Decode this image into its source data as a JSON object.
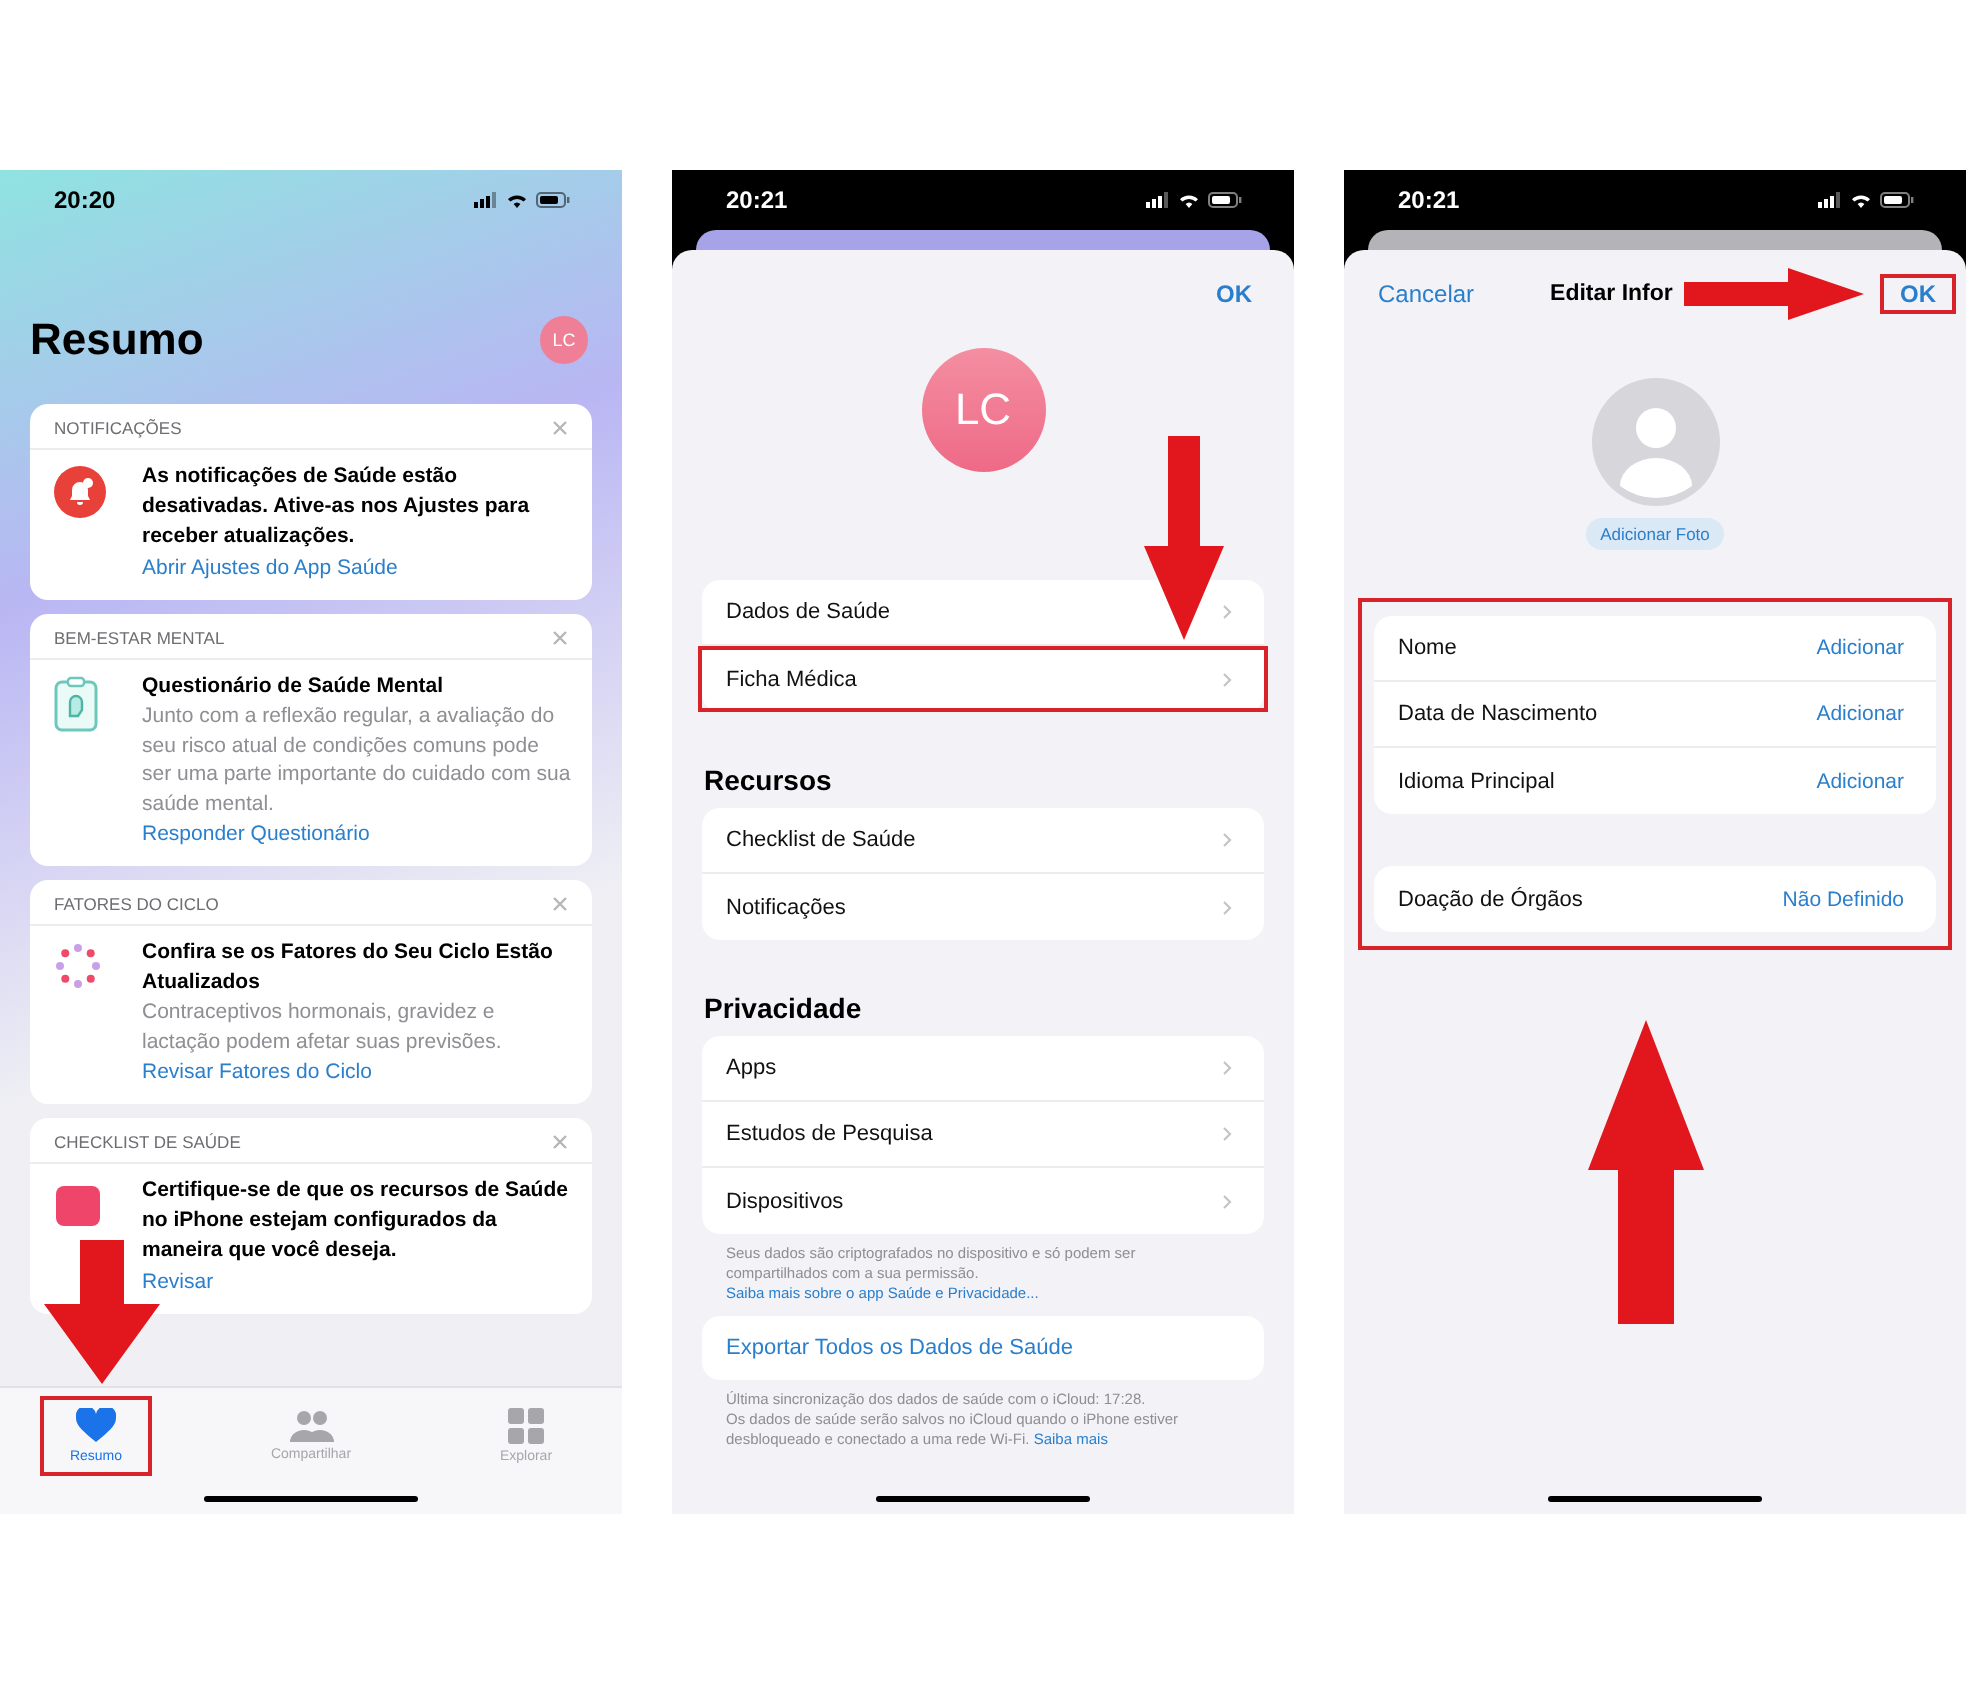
{
  "summary_screen": {
    "time": "20:20",
    "title": "Resumo",
    "avatar": "LC",
    "cards": [
      {
        "header": "NOTIFICAÇÕES",
        "title": "As notificações de Saúde estão desativadas. Ative-as nos Ajustes para receber atualizações.",
        "link": "Abrir Ajustes do App Saúde"
      },
      {
        "header": "BEM-ESTAR MENTAL",
        "title": "Questionário de Saúde Mental",
        "body": "Junto com a reflexão regular, a avaliação do seu risco atual de condições comuns pode ser uma parte importante do cuidado com sua saúde mental.",
        "link": "Responder Questionário"
      },
      {
        "header": "FATORES DO CICLO",
        "title": "Confira se os Fatores do Seu Ciclo Estão Atualizados",
        "body": "Contraceptivos hormonais, gravidez e lactação podem afetar suas previsões.",
        "link": "Revisar Fatores do Ciclo"
      },
      {
        "header": "CHECKLIST DE SAÚDE",
        "title": "Certifique-se de que os recursos de Saúde no iPhone estejam configurados da maneira que você deseja.",
        "link": "Revisar"
      }
    ],
    "tabs": [
      {
        "label": "Resumo",
        "selected": true,
        "highlighted": true
      },
      {
        "label": "Compartilhar",
        "selected": false,
        "highlighted": false
      },
      {
        "label": "Explorar",
        "selected": false,
        "highlighted": false
      }
    ]
  },
  "profile_screen": {
    "time": "20:21",
    "done": "OK",
    "avatar": "LC",
    "sections": [
      {
        "rows": [
          {
            "label": "Dados de Saúde",
            "highlighted": false
          },
          {
            "label": "Ficha Médica",
            "highlighted": true
          }
        ]
      },
      {
        "heading": "Recursos",
        "rows": [
          {
            "label": "Checklist de Saúde",
            "highlighted": false
          },
          {
            "label": "Notificações",
            "highlighted": false
          }
        ]
      },
      {
        "heading": "Privacidade",
        "rows": [
          {
            "label": "Apps",
            "highlighted": false
          },
          {
            "label": "Estudos de Pesquisa",
            "highlighted": false
          },
          {
            "label": "Dispositivos",
            "highlighted": false
          }
        ],
        "footer": "Seus dados são criptografados no dispositivo e só podem ser compartilhados com a sua permissão.",
        "footer_link": "Saiba mais sobre o app Saúde e Privacidade..."
      }
    ],
    "export_button": "Exportar Todos os Dados de Saúde",
    "sync_note": "Última sincronização dos dados de saúde com o iCloud: 17:28.",
    "icloud_note": "Os dados de saúde serão salvos no iCloud quando o iPhone estiver desbloqueado e conectado a uma rede Wi-Fi.",
    "icloud_link": "Saiba mais"
  },
  "edit_screen": {
    "time": "20:21",
    "cancel": "Cancelar",
    "title": "Editar Infor",
    "done": "OK",
    "done_highlighted": true,
    "add_photo": "Adicionar Foto",
    "form_highlighted": true,
    "groups": [
      [
        {
          "label": "Nome",
          "value": "Adicionar"
        },
        {
          "label": "Data de Nascimento",
          "value": "Adicionar"
        },
        {
          "label": "Idioma Principal",
          "value": "Adicionar"
        }
      ],
      [
        {
          "label": "Doação de Órgãos",
          "value": "Não Definido"
        }
      ]
    ]
  }
}
